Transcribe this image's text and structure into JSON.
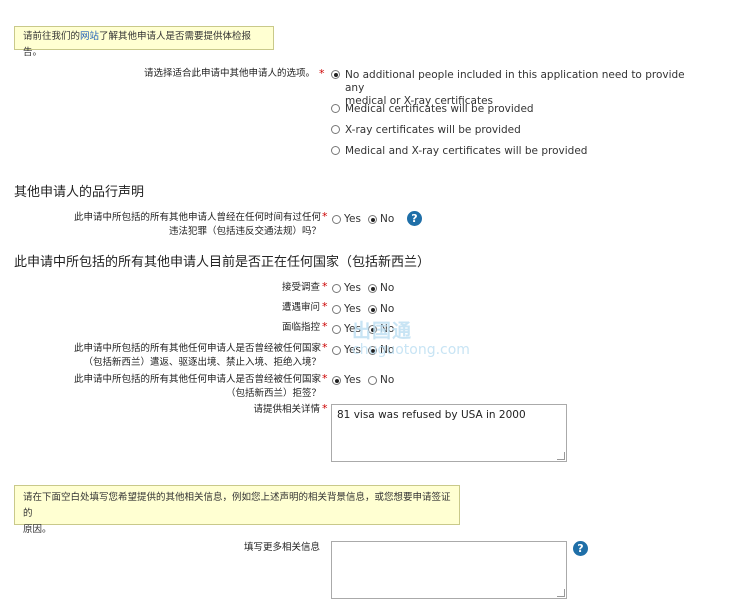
{
  "notice_top": {
    "prefix": "请前往我们的",
    "link": "网站",
    "suffix": "了解其他申请人是否需要提供体检报告。"
  },
  "medical": {
    "label": "请选择适合此申请中其他申请人的选项。",
    "options": [
      {
        "line1": "No additional people included in this application need to provide any",
        "line2": "medical or X-ray certificates",
        "selected": true
      },
      {
        "line1": "Medical certificates will be provided",
        "selected": false
      },
      {
        "line1": "X-ray certificates will be provided",
        "selected": false
      },
      {
        "line1": "Medical and X-ray certificates will be provided",
        "selected": false
      }
    ]
  },
  "section_character": {
    "title": "其他申请人的品行声明"
  },
  "q_crime": {
    "line1": "此申请中所包括的所有其他申请人曾经在任何时间有过任何",
    "line2": "违法犯罪（包括违反交通法规）吗？",
    "yes": "Yes",
    "no": "No",
    "selected": "no"
  },
  "help_icon": {
    "glyph": "?"
  },
  "section_country": {
    "title": "此申请中所包括的所有其他申请人目前是否正在任何国家（包括新西兰）"
  },
  "q_investigation": {
    "label": "接受调查",
    "yes": "Yes",
    "no": "No",
    "selected": "no"
  },
  "q_trial": {
    "label": "遭遇审问",
    "yes": "Yes",
    "no": "No",
    "selected": "no"
  },
  "q_charge": {
    "label": "面临指控",
    "yes": "Yes",
    "no": "No",
    "selected": "no"
  },
  "q_deported": {
    "line1": "此申请中所包括的所有其他任何申请人是否曾经被任何国家",
    "line2": "（包括新西兰）遣返、驱逐出境、禁止入境、拒绝入境？",
    "yes": "Yes",
    "no": "No",
    "selected": "no"
  },
  "q_refused": {
    "line1": "此申请中所包括的所有其他任何申请人是否曾经被任何国家",
    "line2": "（包括新西兰）拒签？",
    "yes": "Yes",
    "no": "No",
    "selected": "yes"
  },
  "details": {
    "label": "请提供相关详情",
    "value": "81 visa was refused by USA in 2000"
  },
  "notice_bottom": {
    "line1": "请在下面空白处填写您希望提供的其他相关信息，例如您上述声明的相关背景信息，或您想要申请签证的",
    "line2": "原因。"
  },
  "more_info": {
    "label": "填写更多相关信息",
    "value": ""
  },
  "watermark": {
    "line1": "出国通",
    "line2": "chuguotong.com"
  },
  "colors": {
    "notice_bg": "#ffffd2",
    "required_star": "#cc0000",
    "help_icon": "#1f6fa8"
  }
}
